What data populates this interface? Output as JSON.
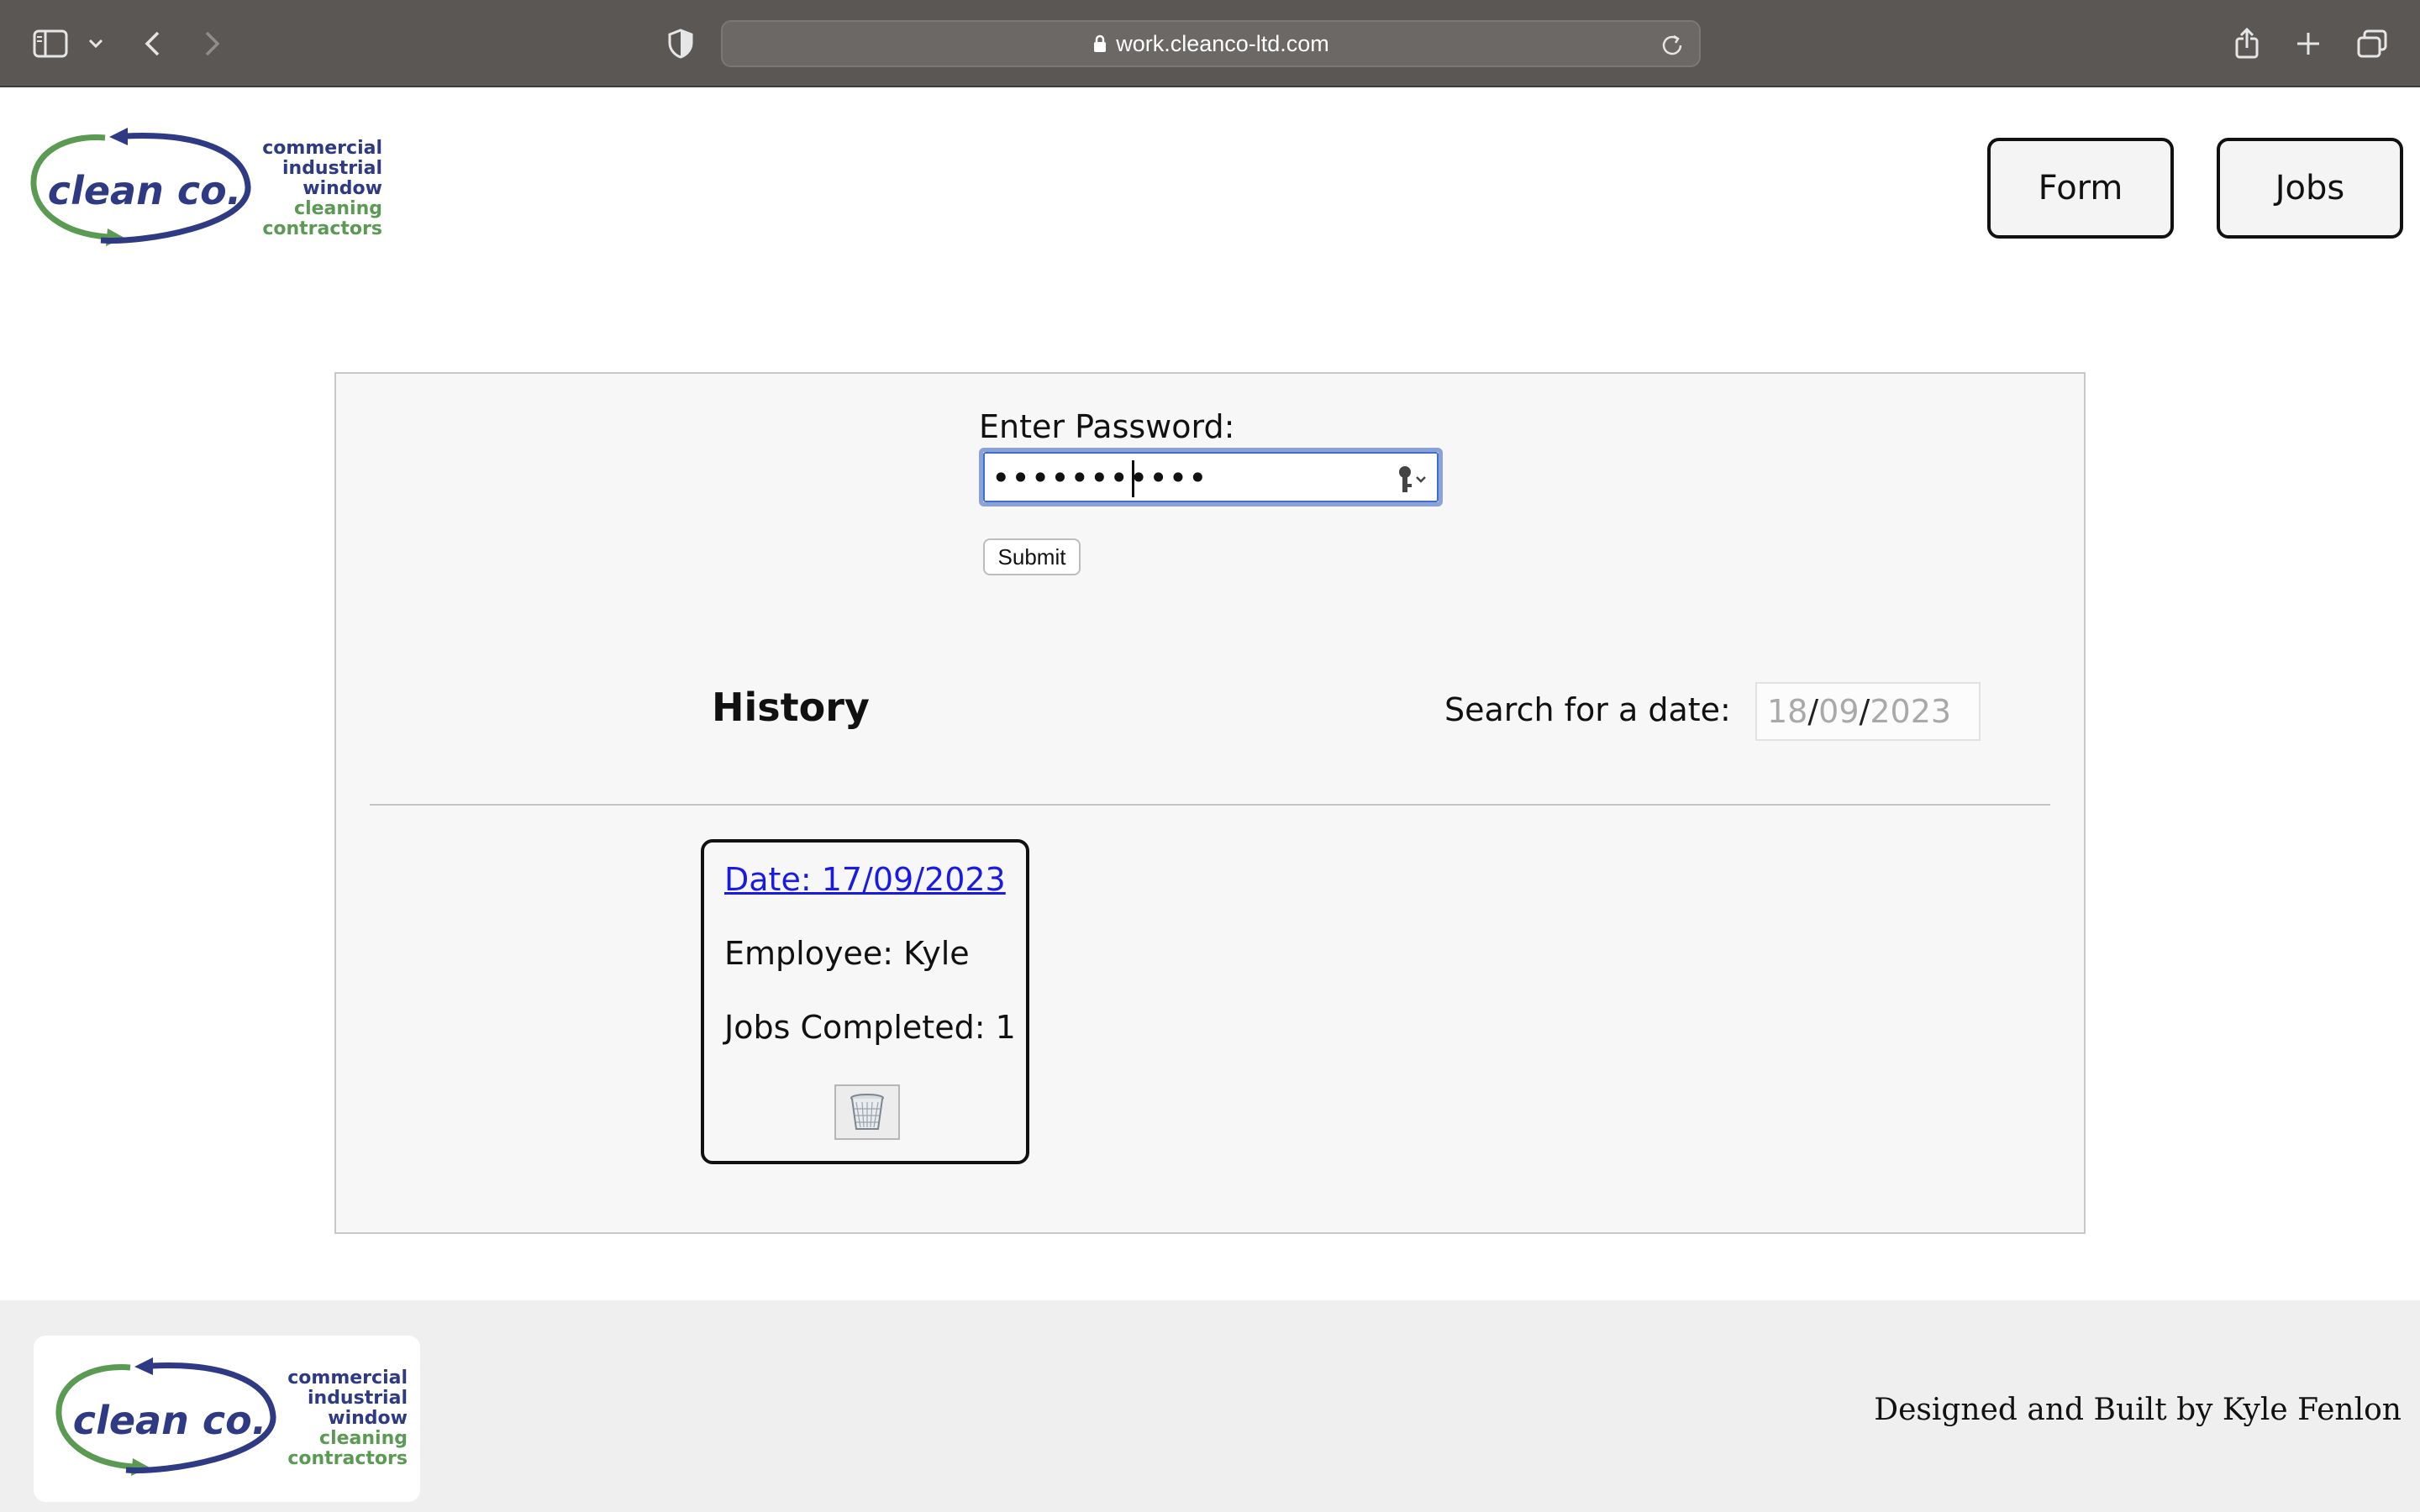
{
  "browser": {
    "url": "work.cleanco-ltd.com"
  },
  "logo": {
    "name": "clean co.",
    "tagline_lines": [
      "commercial",
      "industrial",
      "window",
      "cleaning",
      "contractors"
    ],
    "colors": {
      "blue": "#2e3a84",
      "green": "#5a9a52"
    }
  },
  "nav": {
    "form_label": "Form",
    "jobs_label": "Jobs"
  },
  "auth": {
    "label": "Enter Password:",
    "masked_value": "•••••••••••",
    "submit_label": "Submit"
  },
  "history": {
    "title": "History",
    "search_label": "Search for a date:",
    "date": {
      "day": "18",
      "month": "09",
      "year": "2023"
    },
    "cards": [
      {
        "date": "Date: 17/09/2023 ",
        "employee": "Employee: Kyle",
        "jobs": "Jobs Completed: 1"
      }
    ]
  },
  "footer": {
    "credit": "Designed and Built by Kyle Fenlon"
  },
  "icons": [
    "sidebar-icon",
    "chevron-down-icon",
    "back-icon",
    "forward-icon",
    "shield-icon",
    "lock-icon",
    "reload-icon",
    "share-icon",
    "plus-icon",
    "tabs-icon",
    "key-icon",
    "trash-icon"
  ]
}
